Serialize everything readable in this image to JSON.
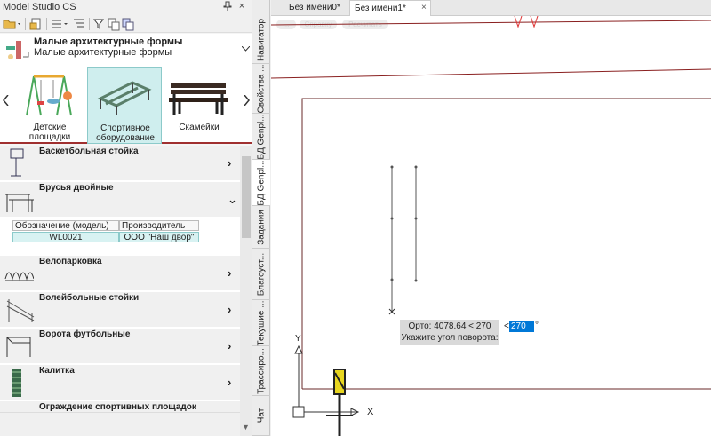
{
  "app": {
    "panel_title": "Model Studio CS",
    "pin": "ᵖ",
    "close": "×"
  },
  "category": {
    "line1": "Малые архитектурные формы",
    "line2": "Малые архитектурные формы"
  },
  "gallery": {
    "items": [
      {
        "label": "Детские площадки"
      },
      {
        "label": "Спортивное оборудование"
      },
      {
        "label": "Скамейки"
      }
    ]
  },
  "list": {
    "items": [
      {
        "name": "Баскетбольная стойка",
        "expanded": false
      },
      {
        "name": "Брусья двойные",
        "expanded": true
      },
      {
        "name": "Велопарковка",
        "expanded": false
      },
      {
        "name": "Волейбольные стойки",
        "expanded": false
      },
      {
        "name": "Ворота футбольные",
        "expanded": false
      },
      {
        "name": "Калитка",
        "expanded": false
      },
      {
        "name": "Ограждение спортивных площадок",
        "expanded": false
      }
    ],
    "detail": {
      "col1": "Обозначение (модель)",
      "col2": "Производитель",
      "val1": "WL0021",
      "val2": "ООО \"Наш двор\""
    }
  },
  "vtabs": [
    "Навигатор",
    "Свойства ...",
    "БД Genpl...",
    "БД Genpl...",
    "Задания",
    "Благоуст...",
    "Текущие ...",
    "Трассиро...",
    "Чат"
  ],
  "doc_tabs": [
    {
      "label": "Без имени0*",
      "selected": false
    },
    {
      "label": "Без имени1*",
      "selected": true,
      "close": "×"
    }
  ],
  "canvas": {
    "pill1": "...",
    "pill2": "Справку",
    "pill3": "Расчитать",
    "tooltip_line1": "Орто: 4078.64 < 270",
    "tooltip_line2": "Укажите угол поворота:",
    "angle_prefix": "<",
    "angle_value": "270",
    "angle_suffix": "°",
    "ucs_y": "Y",
    "ucs_x": "X"
  },
  "colors": {
    "accent_selected": "#cfeeee",
    "separator_red": "#a03030",
    "input_blue": "#0078d7"
  }
}
